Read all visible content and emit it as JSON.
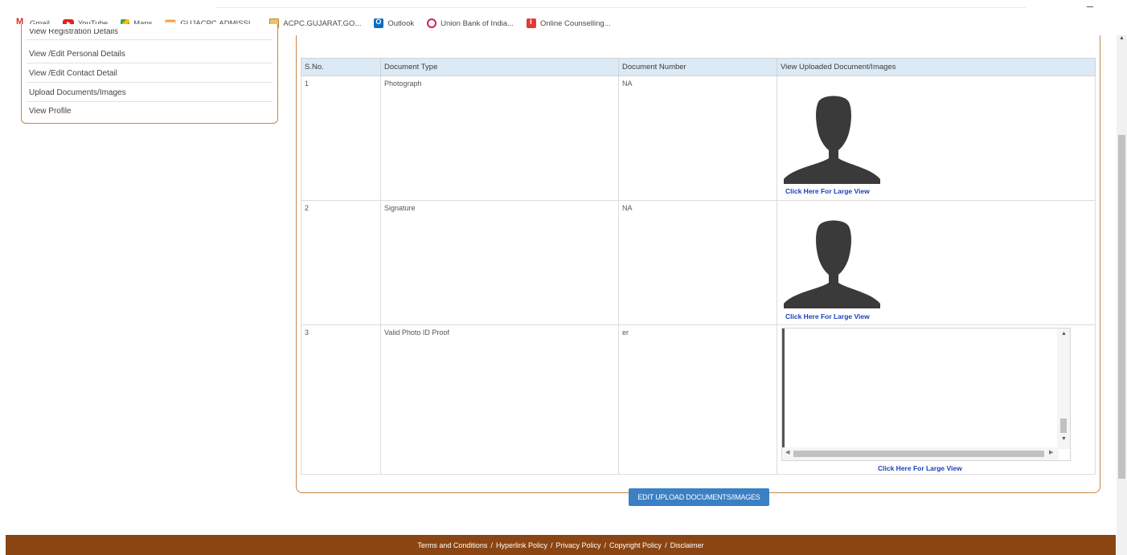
{
  "bookmarks": [
    {
      "label": "Gmail",
      "icon": "gmail-icon"
    },
    {
      "label": "YouTube",
      "icon": "youtube-icon"
    },
    {
      "label": "Maps",
      "icon": "maps-icon"
    },
    {
      "label": "GUJACPC.ADMISSI...",
      "icon": "india-flag-icon"
    },
    {
      "label": "ACPC.GUJARAT.GO...",
      "icon": "acpc-icon"
    },
    {
      "label": "Outlook",
      "icon": "outlook-icon"
    },
    {
      "label": "Union Bank of India...",
      "icon": "union-bank-icon"
    },
    {
      "label": "Online Counselling...",
      "icon": "online-counselling-icon"
    }
  ],
  "sidebar": {
    "items": [
      {
        "label": "View Registration Details"
      },
      {
        "label": "View /Edit Personal Details"
      },
      {
        "label": "View /Edit Contact Detail"
      },
      {
        "label": "Upload Documents/Images"
      },
      {
        "label": "View Profile"
      }
    ]
  },
  "table": {
    "headers": [
      "S.No.",
      "Document Type",
      "Document Number",
      "View Uploaded Document/Images"
    ],
    "rows": [
      {
        "sno": "1",
        "type": "Photograph",
        "number": "NA",
        "link": "Click Here For Large View"
      },
      {
        "sno": "2",
        "type": "Signature",
        "number": "NA",
        "link": "Click Here For Large View"
      },
      {
        "sno": "3",
        "type": "Valid Photo ID Proof",
        "number": "er",
        "link": "Click Here For Large View"
      }
    ]
  },
  "edit_button": "EDIT UPLOAD DOCUMENTS/IMAGES",
  "footer": {
    "links": [
      "Terms and Conditions",
      "Hyperlink Policy",
      "Privacy Policy",
      "Copyright Policy",
      "Disclaimer"
    ],
    "separator": "/"
  },
  "colors": {
    "accent_border": "#c7854a",
    "footer_bg": "#8b4513",
    "header_bg": "#dceaf5",
    "button_bg": "#3b7fc4",
    "link": "#1a3fbf"
  }
}
